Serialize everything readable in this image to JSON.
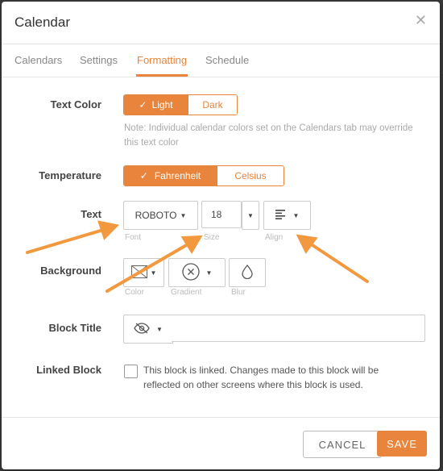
{
  "dialog": {
    "title": "Calendar",
    "close_icon": "close-icon"
  },
  "tabs": [
    {
      "label": "Calendars",
      "active": false
    },
    {
      "label": "Settings",
      "active": false
    },
    {
      "label": "Formatting",
      "active": true
    },
    {
      "label": "Schedule",
      "active": false
    }
  ],
  "text_color": {
    "label": "Text Color",
    "options": [
      "Light",
      "Dark"
    ],
    "selected": "Light",
    "note": "Note: Individual calendar colors set on the Calendars tab may override this text color"
  },
  "temperature": {
    "label": "Temperature",
    "options": [
      "Fahrenheit",
      "Celsius"
    ],
    "selected": "Fahrenheit"
  },
  "text": {
    "label": "Text",
    "font": "ROBOTO",
    "font_caption": "Font",
    "size": "18",
    "size_caption": "Size",
    "align_caption": "Align",
    "align_icon": "align-left-icon"
  },
  "background": {
    "label": "Background",
    "color_caption": "Color",
    "gradient_caption": "Gradient",
    "blur_caption": "Blur"
  },
  "block_title": {
    "label": "Block Title",
    "visibility_icon": "eye-off-icon",
    "value": ""
  },
  "linked_block": {
    "label": "Linked Block",
    "checked": false,
    "text": "This block is linked. Changes made to this block will be reflected on other screens where this block is used."
  },
  "footer": {
    "cancel_label": "CANCEL",
    "save_label": "SAVE"
  },
  "colors": {
    "accent": "#e8843b",
    "annotation_arrow": "#f2983e"
  }
}
